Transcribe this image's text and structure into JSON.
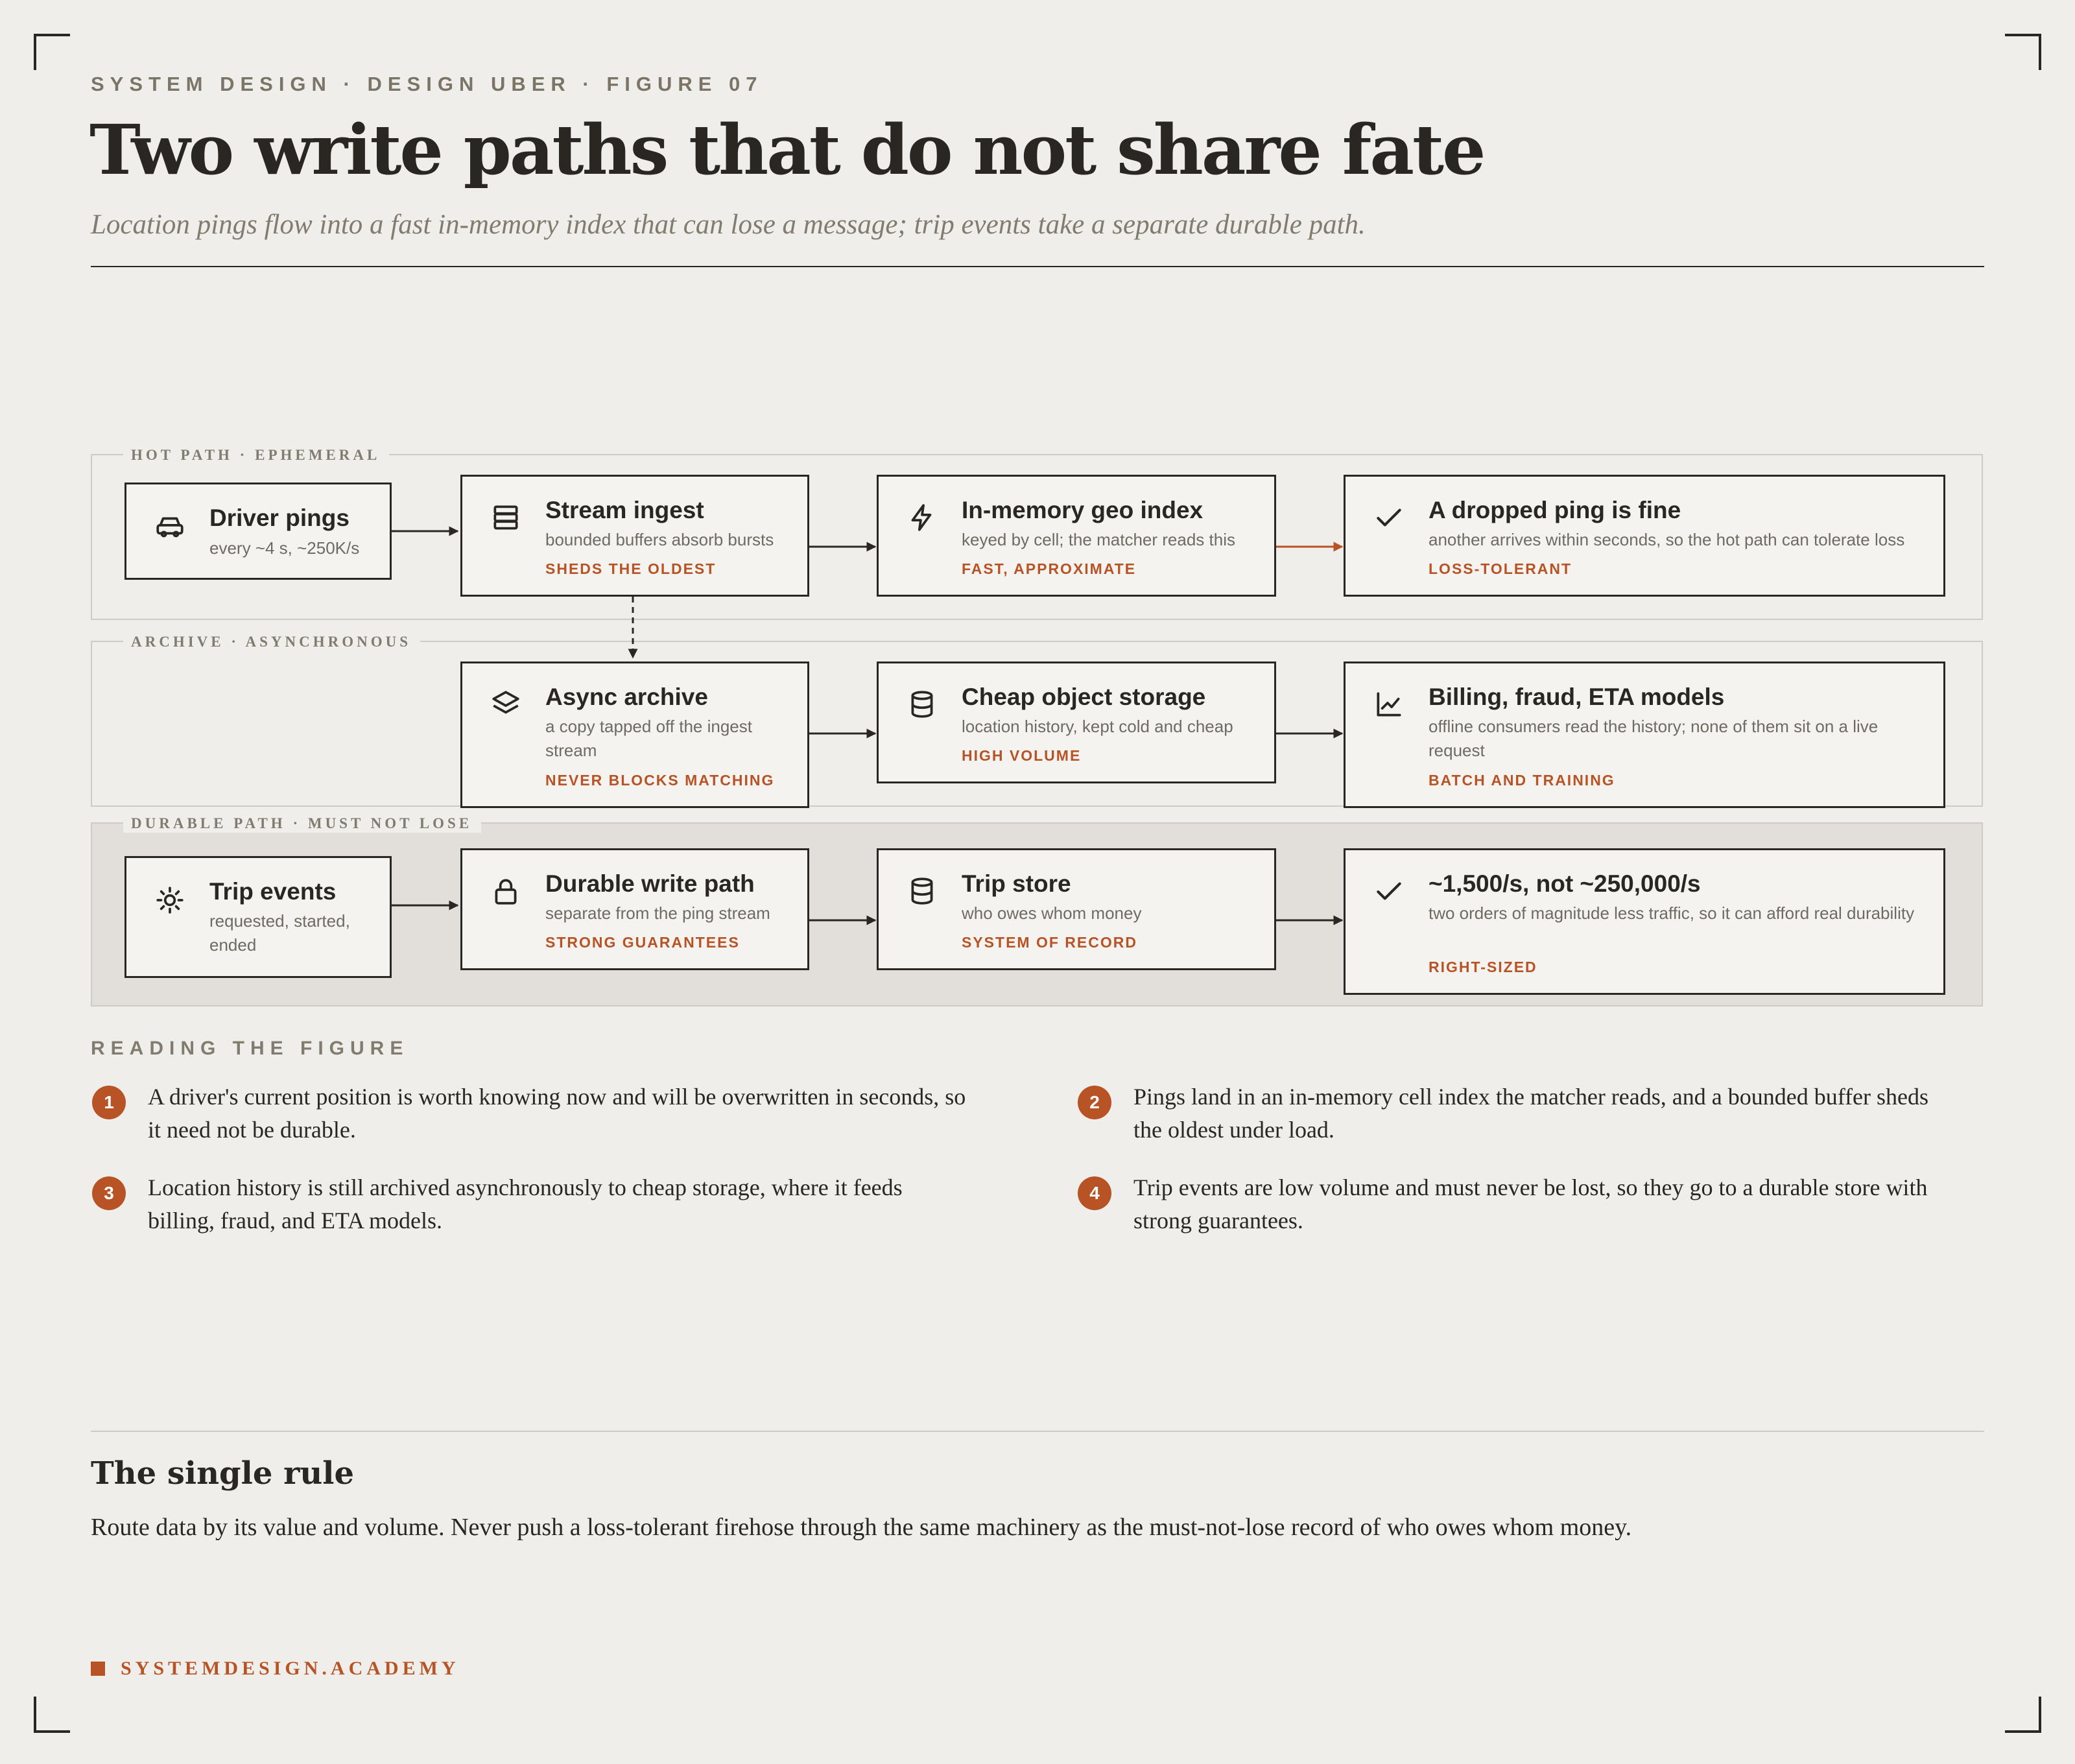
{
  "header": {
    "eyebrow": "SYSTEM DESIGN · DESIGN UBER · FIGURE 07",
    "title": "Two write paths that do not share fate",
    "subtitle": "Location pings flow into a fast in-memory index that can lose a message; trip events take a separate durable path."
  },
  "bands": {
    "hot": "HOT PATH · EPHEMERAL",
    "archive": "ARCHIVE · ASYNCHRONOUS",
    "durable": "DURABLE PATH · MUST NOT LOSE"
  },
  "nodes": {
    "driver_pings": {
      "title": "Driver pings",
      "sub": "every ~4 s, ~250K/s",
      "icon": "car-icon"
    },
    "stream_ingest": {
      "title": "Stream ingest",
      "sub": "bounded buffers absorb bursts",
      "tag": "SHEDS THE OLDEST",
      "icon": "stack-icon"
    },
    "geo_index": {
      "title": "In-memory geo index",
      "sub": "keyed by cell; the matcher reads this",
      "tag": "FAST, APPROXIMATE",
      "icon": "lightning-icon"
    },
    "dropped_ping": {
      "title": "A dropped ping is fine",
      "sub": "another arrives within seconds, so the hot path can tolerate loss",
      "tag": "LOSS-TOLERANT",
      "icon": "check-icon"
    },
    "async_archive": {
      "title": "Async archive",
      "sub": "a copy tapped off the ingest stream",
      "tag": "NEVER BLOCKS MATCHING",
      "icon": "layers-icon"
    },
    "object_storage": {
      "title": "Cheap object storage",
      "sub": "location history, kept cold and cheap",
      "tag": "HIGH VOLUME",
      "icon": "database-icon"
    },
    "billing_models": {
      "title": "Billing, fraud, ETA models",
      "sub": "offline consumers read the history; none of them sit on a live request",
      "tag": "BATCH AND TRAINING",
      "icon": "chart-icon"
    },
    "trip_events": {
      "title": "Trip events",
      "sub": "requested, started, ended",
      "icon": "sun-icon"
    },
    "durable_write": {
      "title": "Durable write path",
      "sub": "separate from the ping stream",
      "tag": "STRONG GUARANTEES",
      "icon": "lock-icon"
    },
    "trip_store": {
      "title": "Trip store",
      "sub": "who owes whom money",
      "tag": "SYSTEM OF RECORD",
      "icon": "database-icon"
    },
    "right_sized": {
      "title": "~1,500/s, not ~250,000/s",
      "sub": "two orders of magnitude less traffic, so it can afford real durability",
      "tag": "RIGHT-SIZED",
      "icon": "check-icon"
    }
  },
  "reading": {
    "heading": "READING THE FIGURE",
    "notes": [
      {
        "num": "1",
        "text": "A driver's current position is worth knowing now and will be overwritten in seconds, so it need not be durable."
      },
      {
        "num": "2",
        "text": "Pings land in an in-memory cell index the matcher reads, and a bounded buffer sheds the oldest under load."
      },
      {
        "num": "3",
        "text": "Location history is still archived asynchronously to cheap storage, where it feeds billing, fraud, and ETA models."
      },
      {
        "num": "4",
        "text": "Trip events are low volume and must never be lost, so they go to a durable store with strong guarantees."
      }
    ]
  },
  "rule": {
    "title": "The single rule",
    "text": "Route data by its value and volume. Never push a loss-tolerant firehose through the same machinery as the must-not-lose record of who owes whom money."
  },
  "footer": {
    "brand": "SYSTEMDESIGN.ACADEMY"
  },
  "colors": {
    "accent": "#b75325",
    "ink": "#2a2723",
    "paper": "#f0eeeb",
    "muted": "#827c70"
  }
}
